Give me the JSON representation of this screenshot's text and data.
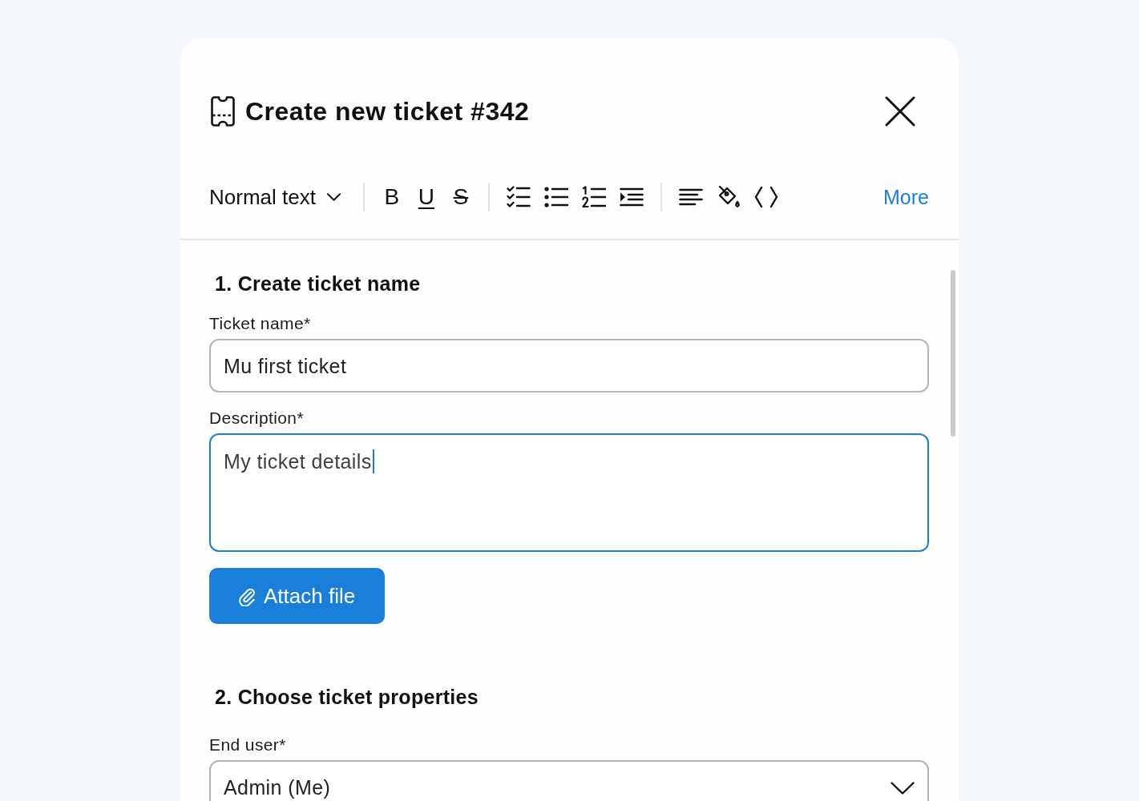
{
  "dialog": {
    "title": "Create new ticket #342"
  },
  "toolbar": {
    "text_style": "Normal text",
    "format": [
      {
        "kind": "bold",
        "label": "B"
      },
      {
        "kind": "underline",
        "label": "U"
      },
      {
        "kind": "strike",
        "label": "S"
      }
    ],
    "more": "More"
  },
  "sections": [
    {
      "heading": "1. Create ticket name",
      "fields": [
        {
          "kind": "text",
          "label": "Ticket name*",
          "value": "Mu first ticket",
          "focused": false
        },
        {
          "kind": "textarea",
          "label": "Description*",
          "value": "My ticket details",
          "focused": true
        }
      ],
      "attach_button": "Attach file"
    },
    {
      "heading": "2. Choose ticket properties",
      "fields": [
        {
          "kind": "select",
          "label": "End user*",
          "value": "Admin (Me)",
          "focused": false
        }
      ]
    }
  ]
}
